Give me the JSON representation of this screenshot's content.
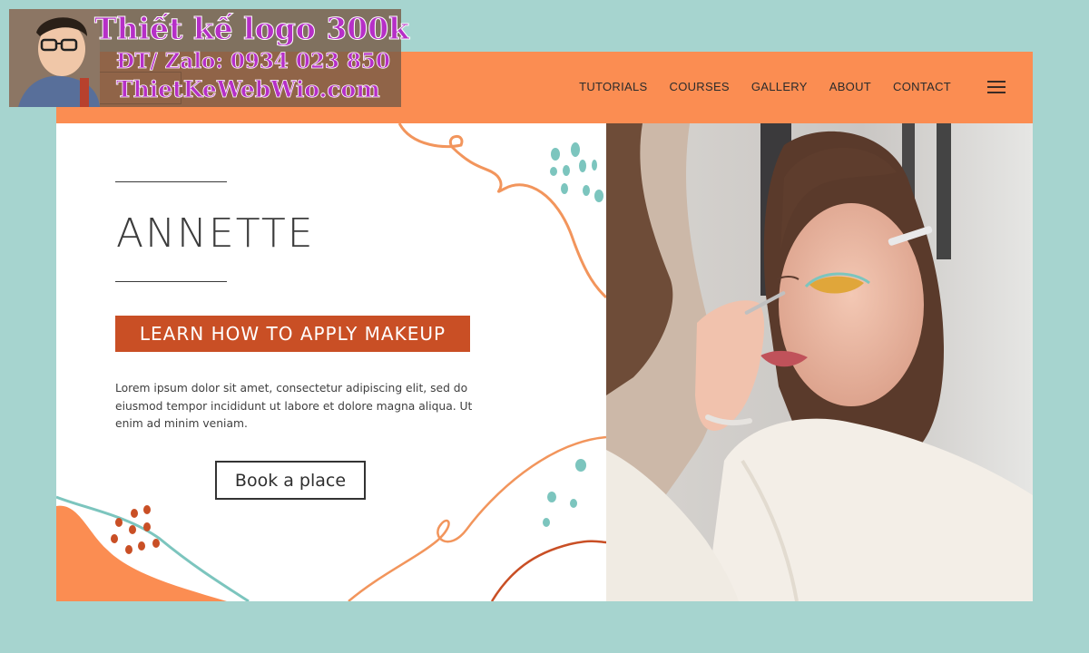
{
  "nav": {
    "items": [
      "TUTORIALS",
      "COURSES",
      "GALLERY",
      "ABOUT",
      "CONTACT"
    ],
    "menu_icon": "hamburger-icon"
  },
  "hero": {
    "title": "ANNETTE",
    "tagline": "LEARN HOW TO APPLY MAKEUP",
    "body": "Lorem ipsum dolor sit amet, consectetur adipiscing elit, sed do eiusmod tempor incididunt ut labore et dolore magna aliqua. Ut enim ad minim veniam.",
    "cta": "Book a place"
  },
  "promo": {
    "title": "Thiết kế logo 300k",
    "phone": "ĐT/ Zalo: 0934 023 850",
    "site": "ThietKeWebWio.com"
  },
  "colors": {
    "background": "#a6d4cf",
    "header": "#fb8d52",
    "tagline_bg": "#c94f25",
    "accent_teal": "#7cc5be",
    "promo_text": "#b62fc7"
  }
}
